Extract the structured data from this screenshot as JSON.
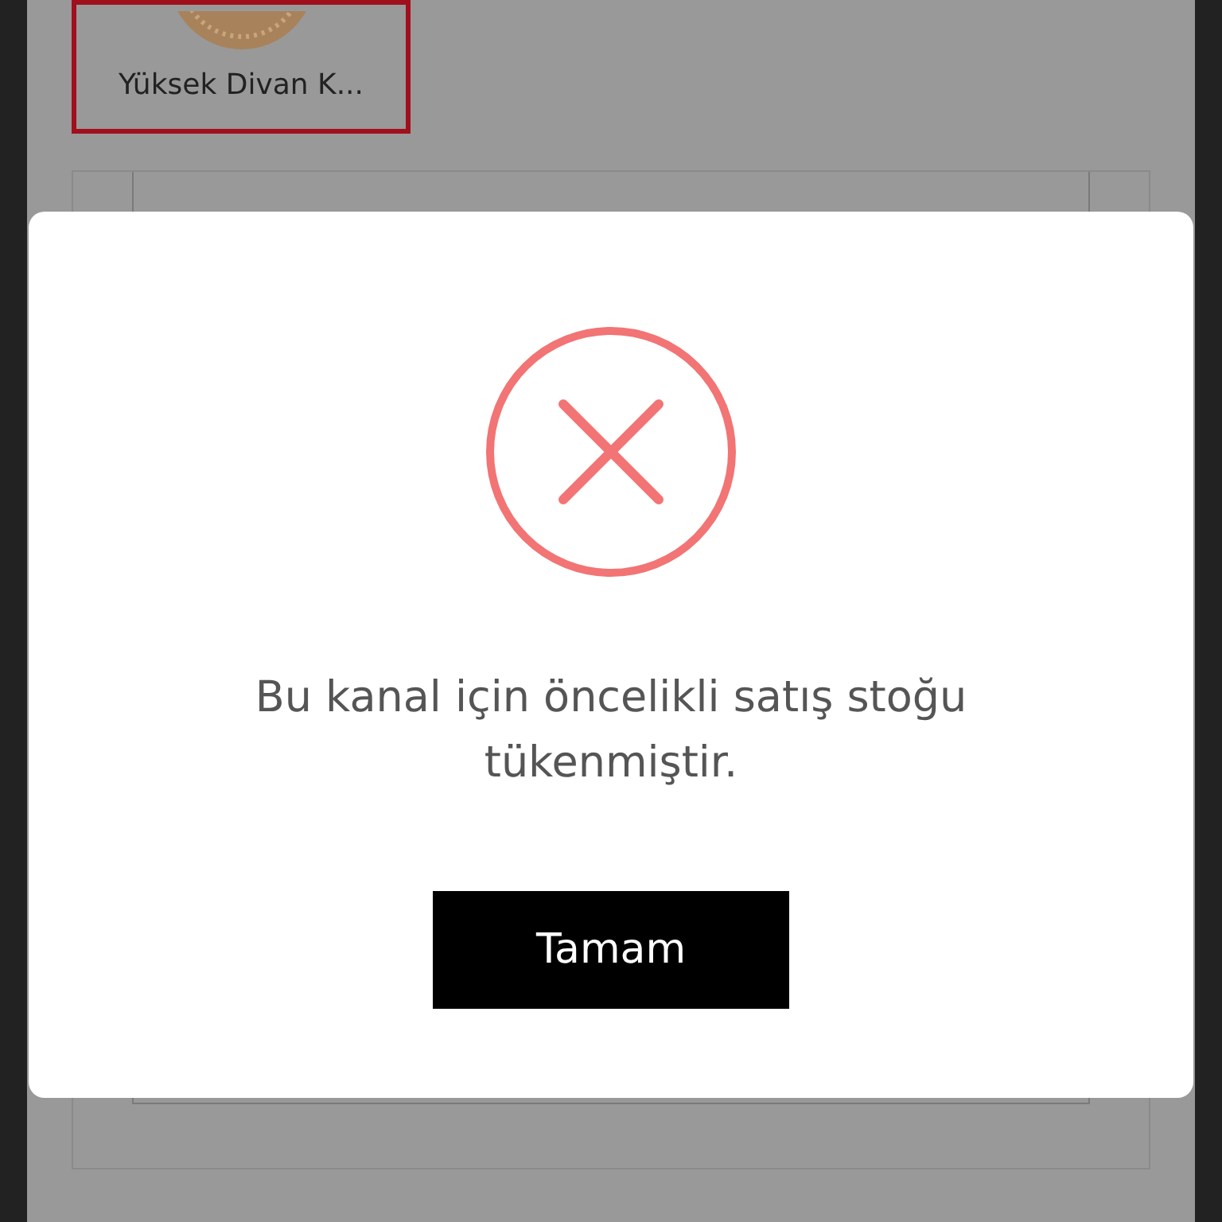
{
  "background_card": {
    "label": "Yüksek Divan K...",
    "selected": true
  },
  "dialog": {
    "kind": "error",
    "message": "Bu kanal için öncelikli satış stoğu tükenmiştir.",
    "button": "Tamam"
  }
}
